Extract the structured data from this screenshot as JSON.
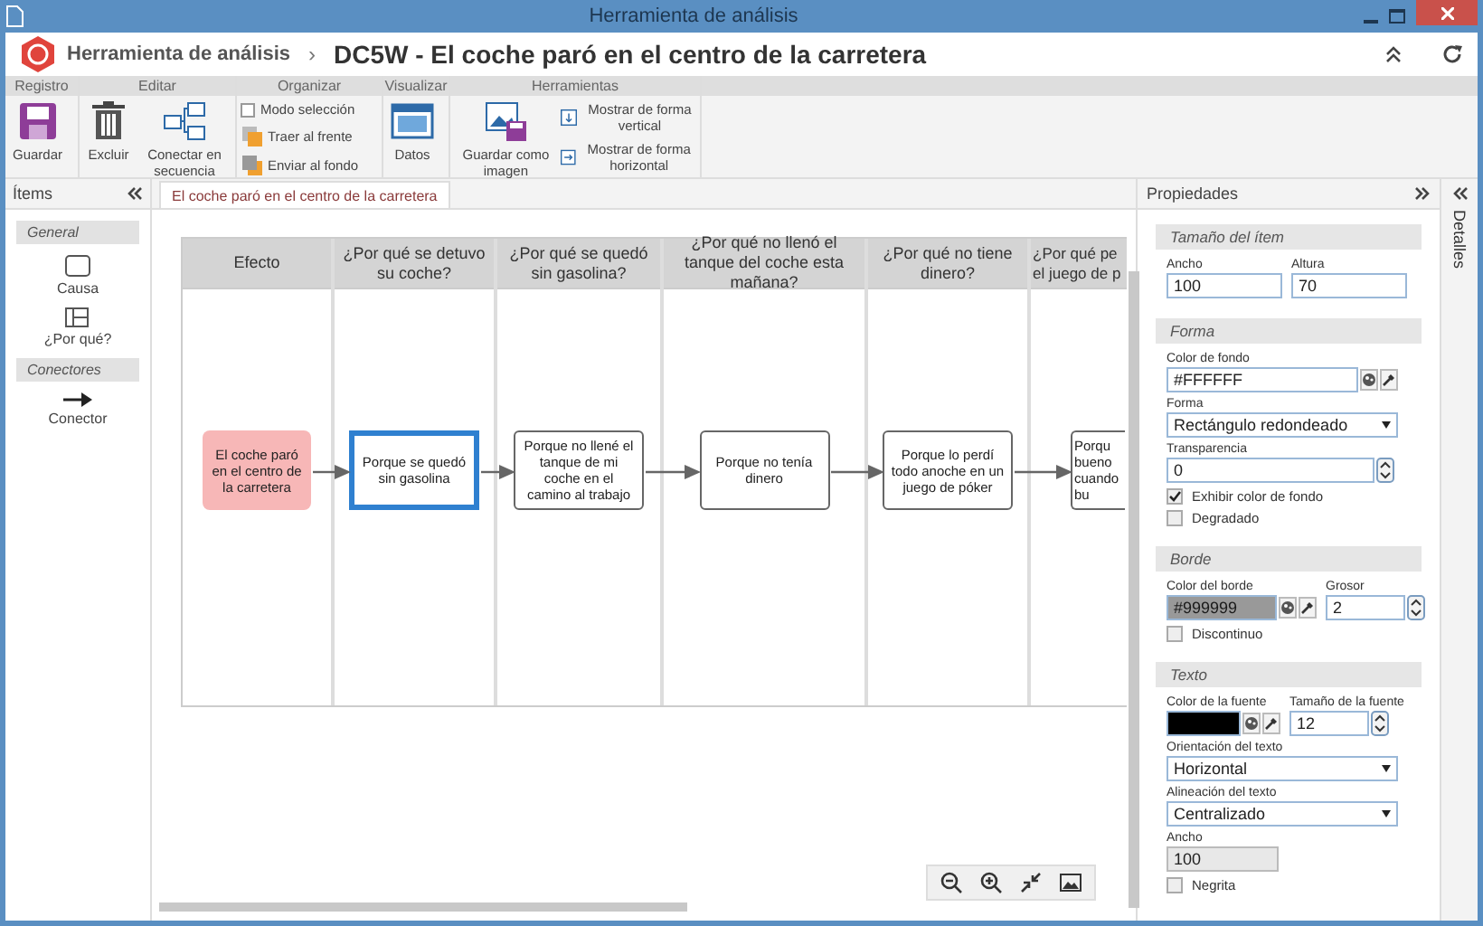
{
  "window": {
    "title": "Herramienta de análisis"
  },
  "header": {
    "breadcrumb": "Herramienta de análisis",
    "separator": "›",
    "title": "DC5W - El coche paró en el centro de la carretera"
  },
  "ribbon": {
    "groups": [
      {
        "label": "Registro",
        "items": [
          {
            "kind": "big",
            "label": "Guardar"
          }
        ]
      },
      {
        "label": "Editar",
        "items": [
          {
            "kind": "big",
            "label": "Excluir"
          },
          {
            "kind": "big",
            "label": "Conectar en secuencia"
          }
        ]
      },
      {
        "label": "Organizar",
        "items": [
          {
            "kind": "check",
            "label": "Modo selección",
            "checked": false
          },
          {
            "kind": "small",
            "label": "Traer al frente"
          },
          {
            "kind": "small",
            "label": "Enviar al fondo"
          }
        ]
      },
      {
        "label": "Visualizar",
        "items": [
          {
            "kind": "big",
            "label": "Datos"
          }
        ]
      },
      {
        "label": "Herramientas",
        "items": [
          {
            "kind": "big",
            "label": "Guardar como imagen"
          },
          {
            "kind": "small",
            "label": "Mostrar de forma vertical"
          },
          {
            "kind": "small",
            "label": "Mostrar de forma horizontal"
          }
        ]
      }
    ]
  },
  "items_panel": {
    "title": "Ítems",
    "sections": [
      {
        "title": "General",
        "items": [
          "Causa",
          "¿Por qué?"
        ]
      },
      {
        "title": "Conectores",
        "items": [
          "Conector"
        ]
      }
    ]
  },
  "tabs": [
    {
      "label": "El coche paró en el centro de la carretera",
      "selected": true
    }
  ],
  "diagram": {
    "columns": [
      {
        "header": "Efecto",
        "node": {
          "kind": "effect",
          "text": "El coche paró en el centro de la carretera",
          "selected": false
        }
      },
      {
        "header": "¿Por qué se detuvo su coche?",
        "node": {
          "kind": "cause",
          "text": "Porque se quedó sin gasolina",
          "selected": true
        }
      },
      {
        "header": "¿Por qué se quedó sin gasolina?",
        "node": {
          "kind": "cause",
          "text": "Porque no llené el tanque de mi coche en el camino al trabajo",
          "selected": false
        }
      },
      {
        "header": "¿Por qué no llenó el tanque del coche esta mañana?",
        "node": {
          "kind": "cause",
          "text": "Porque no tenía dinero",
          "selected": false
        }
      },
      {
        "header": "¿Por qué no tiene dinero?",
        "node": {
          "kind": "cause",
          "text": "Porque lo perdí todo anoche en un juego de póker",
          "selected": false
        }
      },
      {
        "header": "¿Por qué pe\nel juego de p",
        "node": {
          "kind": "cut",
          "text": "Porqu\nbueno\ncuando\nbu",
          "selected": false
        }
      }
    ]
  },
  "properties": {
    "title": "Propiedades",
    "sections": [
      {
        "title": "Tamaño del ítem",
        "rows": [
          [
            {
              "kind": "text",
              "label": "Ancho",
              "value": "100",
              "disabled": false
            },
            {
              "kind": "text",
              "label": "Altura",
              "value": "70",
              "disabled": false
            }
          ]
        ]
      },
      {
        "title": "Forma",
        "rows": [
          [
            {
              "kind": "color",
              "label": "Color de fondo",
              "value": "#FFFFFF",
              "color": "#ffffff"
            }
          ],
          [
            {
              "kind": "select",
              "label": "Forma",
              "value": "Rectángulo redondeado"
            }
          ],
          [
            {
              "kind": "spin",
              "label": "Transparencia",
              "value": "0"
            }
          ],
          [
            {
              "kind": "check",
              "label": "Exhibir color de fondo",
              "checked": true
            }
          ],
          [
            {
              "kind": "check",
              "label": "Degradado",
              "checked": false
            }
          ]
        ]
      },
      {
        "title": "Borde",
        "rows": [
          [
            {
              "kind": "color",
              "label": "Color del borde",
              "value": "#999999",
              "color": "#999999"
            },
            {
              "kind": "spin",
              "label": "Grosor",
              "value": "2"
            }
          ],
          [
            {
              "kind": "check",
              "label": "Discontinuo",
              "checked": false
            }
          ]
        ]
      },
      {
        "title": "Texto",
        "rows": [
          [
            {
              "kind": "color",
              "label": "Color de la fuente",
              "color": "#000000"
            },
            {
              "kind": "spin",
              "label": "Tamaño de la fuente",
              "value": "12"
            }
          ],
          [
            {
              "kind": "select",
              "label": "Orientación del texto",
              "value": "Horizontal"
            }
          ],
          [
            {
              "kind": "select",
              "label": "Alineación del texto",
              "value": "Centralizado"
            }
          ],
          [
            {
              "kind": "text",
              "label": "Ancho",
              "value": "100",
              "disabled": true
            }
          ],
          [
            {
              "kind": "check",
              "label": "Negrita",
              "checked": false
            }
          ]
        ]
      }
    ]
  },
  "side_tab": {
    "label": "Detalles"
  }
}
